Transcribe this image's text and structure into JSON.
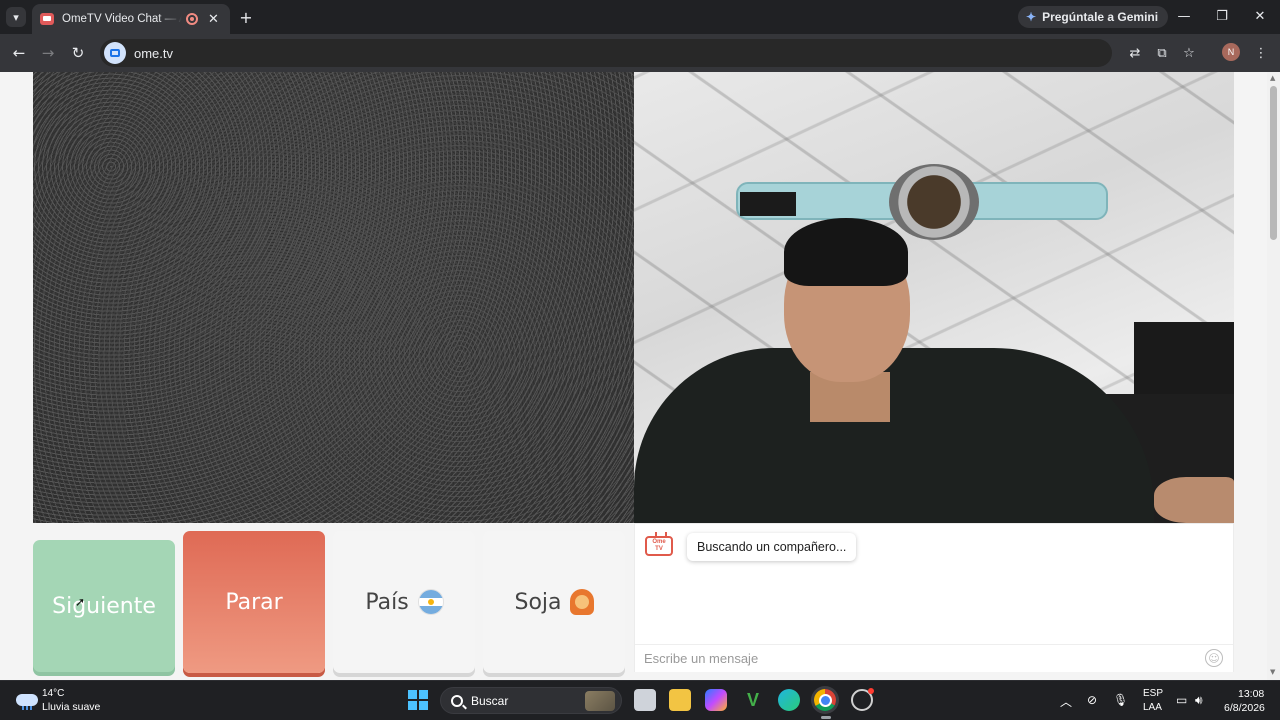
{
  "browser": {
    "tab_title": "OmeTV Video Chat — Alternativa",
    "new_tab_symbol": "+",
    "close_symbol": "✕",
    "gemini_label": "Pregúntale a Gemini",
    "url": "ome.tv",
    "profile_initial": "N"
  },
  "ometv": {
    "buttons": {
      "next": "Siguiente",
      "stop": "Parar",
      "country": "País",
      "gender": "Soja"
    },
    "chat": {
      "logo_top": "Ome",
      "logo_bottom": "TV",
      "status_message": "Buscando un compañero...",
      "input_placeholder": "Escribe un mensaje"
    }
  },
  "taskbar": {
    "weather_temp": "14°C",
    "weather_desc": "Lluvia suave",
    "search_label": "Buscar",
    "lang_line1": "ESP",
    "lang_line2": "LAA",
    "time": "13:08",
    "date": "6/8/2026"
  },
  "colors": {
    "next_button": "#a4d6b5",
    "stop_button": "#df6a55",
    "brand_red": "#e05a4b"
  }
}
